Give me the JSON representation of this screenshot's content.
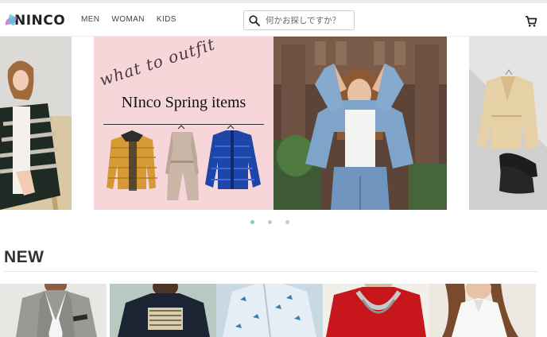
{
  "header": {
    "logo_text": "NINCO",
    "nav": [
      "MEN",
      "WOMAN",
      "KIDS"
    ],
    "search": {
      "placeholder": "何かお探しですか？"
    },
    "icons": {
      "search": "search-icon",
      "cart": "cart-icon"
    }
  },
  "carousel": {
    "featured": {
      "script_text": "what to outfit",
      "title": "NInco Spring items"
    },
    "dots": 3,
    "active_dot": 0
  },
  "new_section": {
    "title": "NEW",
    "product_count": 5
  },
  "colors": {
    "accent_dot": "#7fd0c5",
    "pink_banner": "#f7d6d9",
    "text_dark": "#333333"
  }
}
